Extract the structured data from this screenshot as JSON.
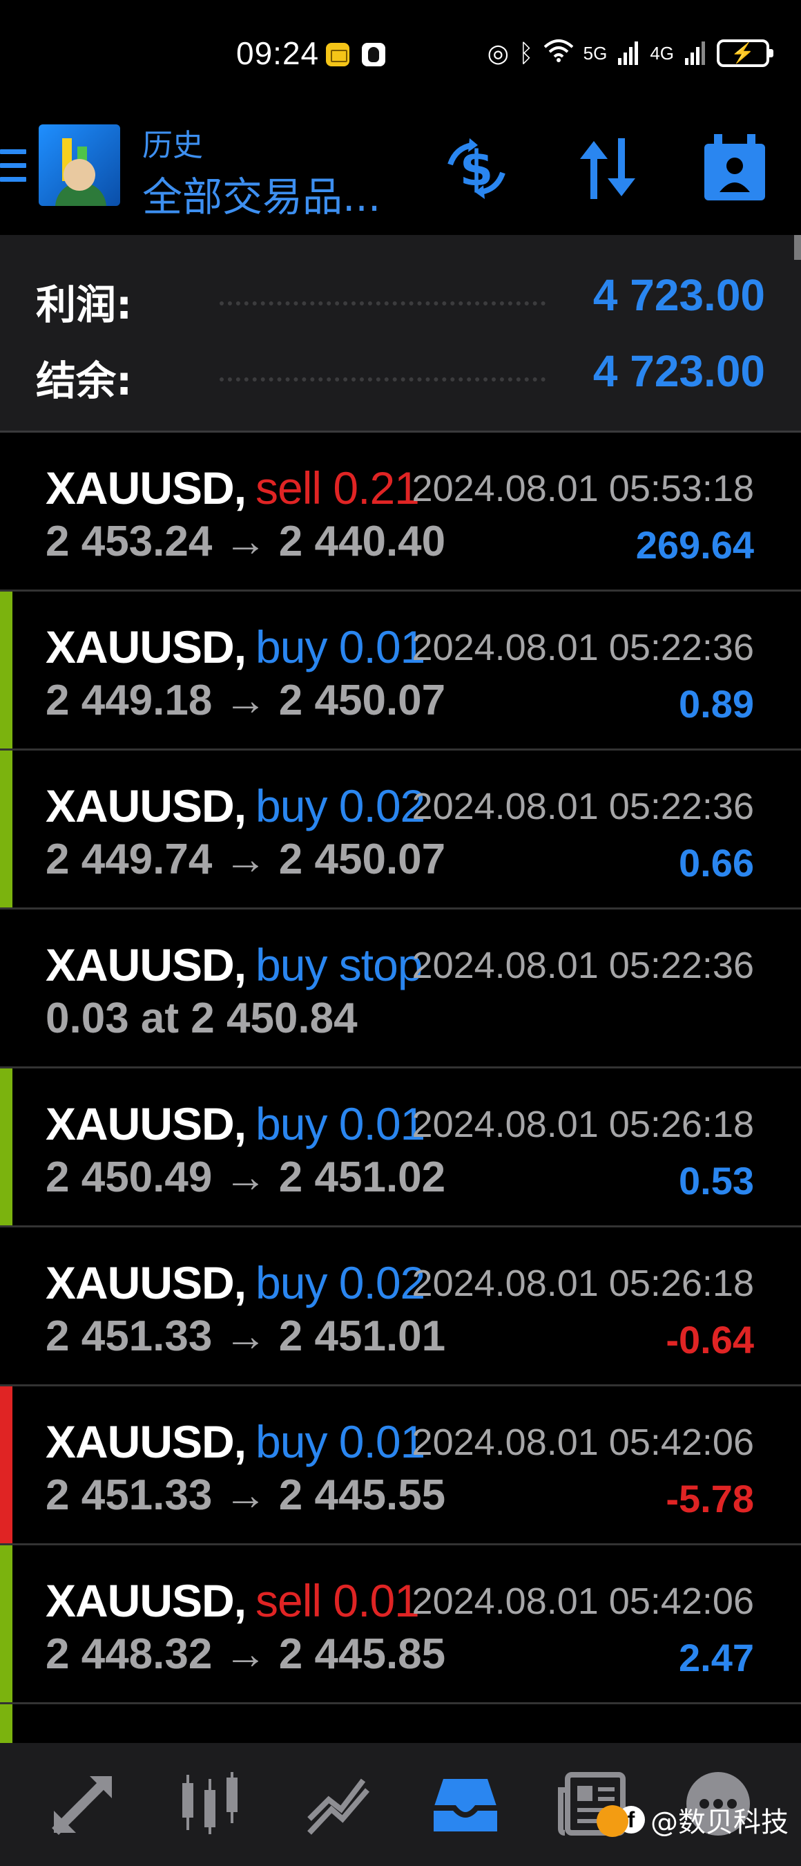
{
  "status_bar": {
    "time": "09:24",
    "network": "5G",
    "network2": "4G"
  },
  "header": {
    "title": "历史",
    "subtitle": "全部交易品..."
  },
  "summary": {
    "profit_label": "利润:",
    "profit_value": "4 723.00",
    "balance_label": "结余:",
    "balance_value": "4 723.00"
  },
  "colors": {
    "blue": "#2a86f0",
    "red": "#e02424",
    "green": "#7bb30e",
    "grey": "#a6a6a8"
  },
  "trades": [
    {
      "symbol": "XAUUSD,",
      "type": "sell 0.21",
      "side": "sell",
      "time": "2024.08.01 05:53:18",
      "prices": "2 453.24 → 2 440.40",
      "profit": "269.64",
      "result": "pos",
      "stripe": "none"
    },
    {
      "symbol": "XAUUSD,",
      "type": "buy 0.01",
      "side": "buy",
      "time": "2024.08.01 05:22:36",
      "prices": "2 449.18 → 2 450.07",
      "profit": "0.89",
      "result": "pos",
      "stripe": "green"
    },
    {
      "symbol": "XAUUSD,",
      "type": "buy 0.02",
      "side": "buy",
      "time": "2024.08.01 05:22:36",
      "prices": "2 449.74 → 2 450.07",
      "profit": "0.66",
      "result": "pos",
      "stripe": "green"
    },
    {
      "symbol": "XAUUSD,",
      "type": "buy stop",
      "side": "buy",
      "time": "2024.08.01 05:22:36",
      "prices": "0.03 at 2 450.84",
      "profit": "",
      "result": "pos",
      "stripe": "none"
    },
    {
      "symbol": "XAUUSD,",
      "type": "buy 0.01",
      "side": "buy",
      "time": "2024.08.01 05:26:18",
      "prices": "2 450.49 → 2 451.02",
      "profit": "0.53",
      "result": "pos",
      "stripe": "green"
    },
    {
      "symbol": "XAUUSD,",
      "type": "buy 0.02",
      "side": "buy",
      "time": "2024.08.01 05:26:18",
      "prices": "2 451.33 → 2 451.01",
      "profit": "-0.64",
      "result": "neg",
      "stripe": "none"
    },
    {
      "symbol": "XAUUSD,",
      "type": "buy 0.01",
      "side": "buy",
      "time": "2024.08.01 05:42:06",
      "prices": "2 451.33 → 2 445.55",
      "profit": "-5.78",
      "result": "neg",
      "stripe": "red"
    },
    {
      "symbol": "XAUUSD,",
      "type": "sell 0.01",
      "side": "sell",
      "time": "2024.08.01 05:42:06",
      "prices": "2 448.32 → 2 445.85",
      "profit": "2.47",
      "result": "pos",
      "stripe": "green"
    }
  ],
  "nav": {
    "items": [
      "trade-icon",
      "quotes-icon",
      "chart-icon",
      "history-icon",
      "news-icon",
      "chat-icon"
    ],
    "active": "history-icon"
  },
  "watermark": {
    "logo": "f",
    "text": "@数贝科技"
  }
}
